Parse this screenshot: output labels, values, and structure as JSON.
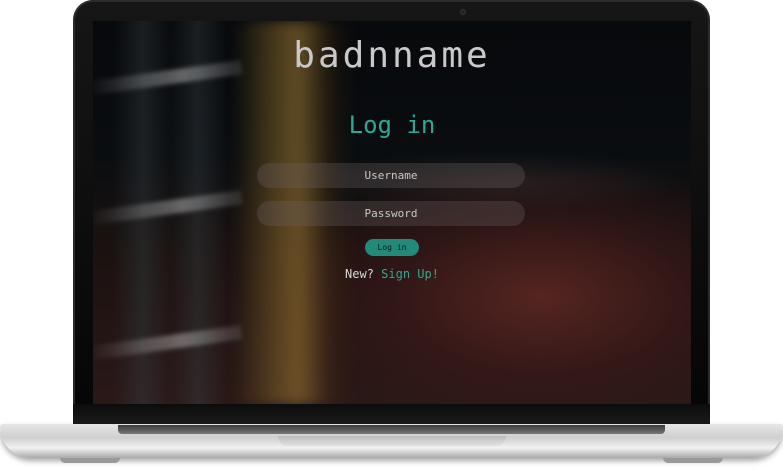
{
  "app": {
    "brand": "badnname"
  },
  "login_form": {
    "heading": "Log in",
    "username_placeholder": "Username",
    "password_placeholder": "Password",
    "submit_label": "Log in",
    "signup_prompt": "New?",
    "signup_link": "Sign Up!"
  },
  "colors": {
    "accent": "#2fa893",
    "button": "#218a78",
    "brand_text": "#c9c9c9"
  }
}
